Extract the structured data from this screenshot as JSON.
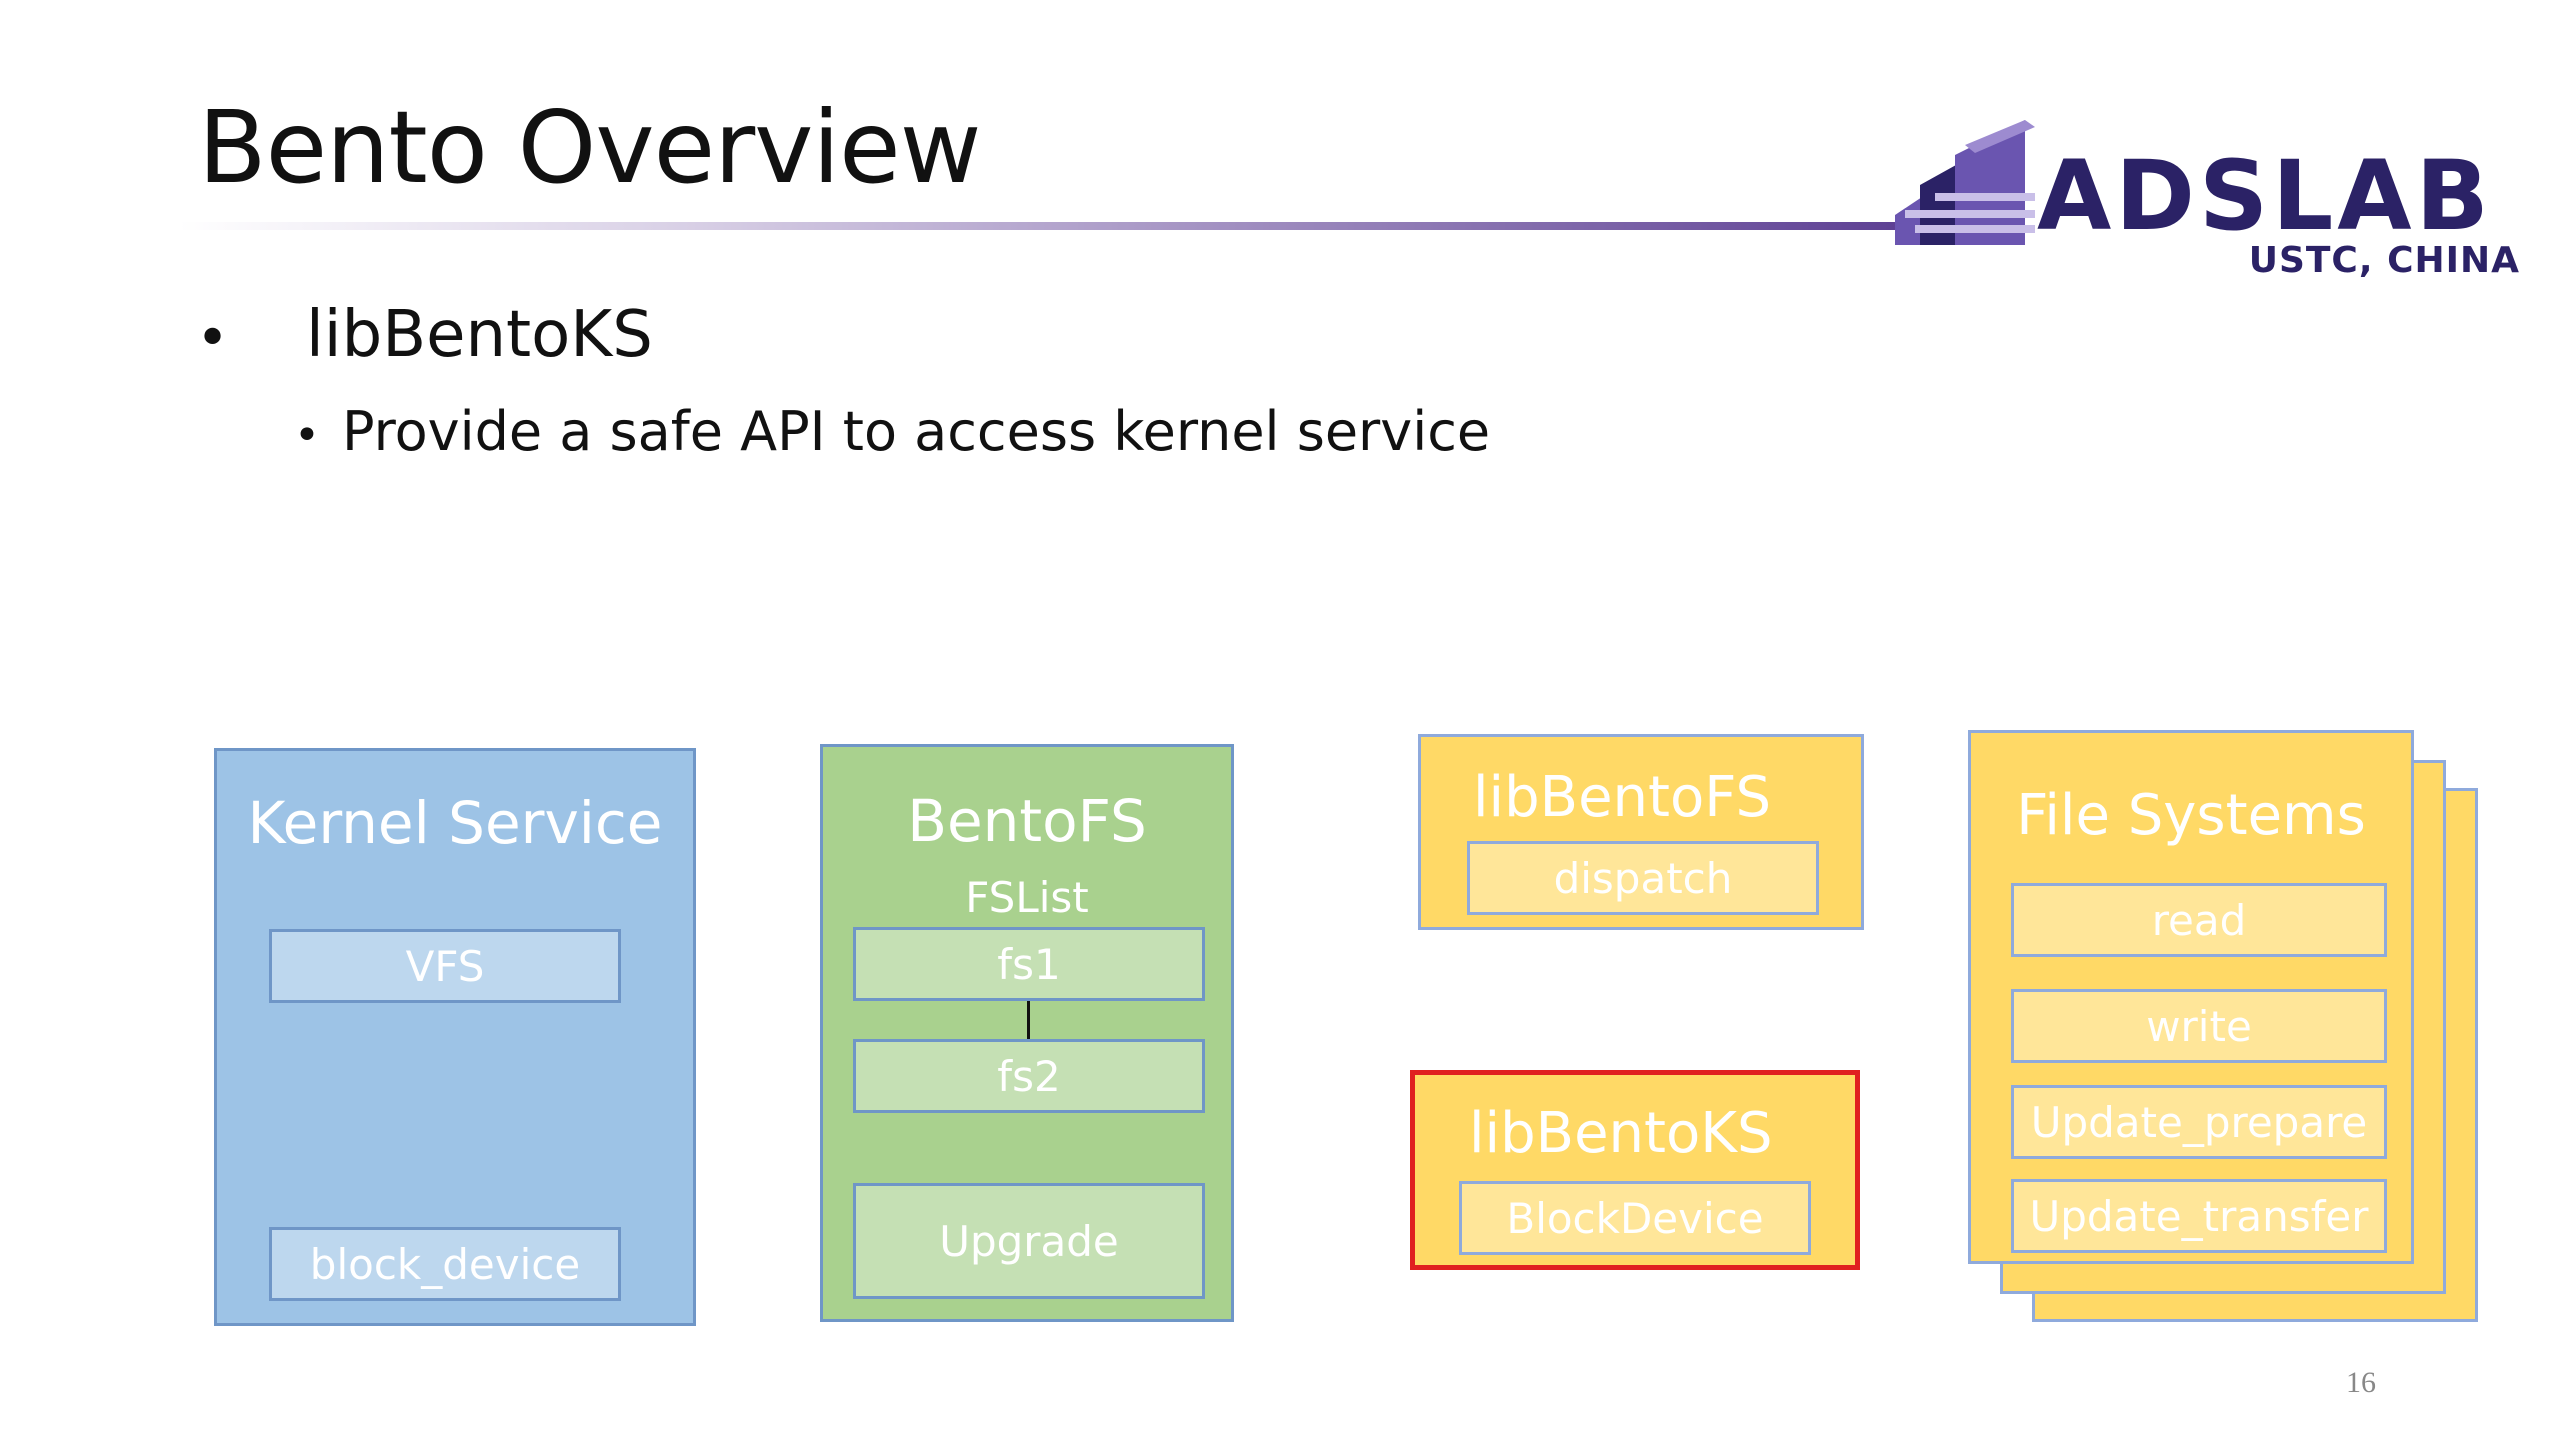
{
  "slide": {
    "title": "Bento Overview",
    "page_number": "16"
  },
  "logo": {
    "small_text": "USTC, CHINA",
    "big_text": "ADSLAB",
    "colors": {
      "dark": "#2b2266",
      "light": "#9d8bd0",
      "mid": "#6a55b0"
    }
  },
  "bullets": [
    {
      "text": "libBentoKS",
      "level": 1
    },
    {
      "text": "Provide a safe API to access kernel service",
      "level": 2
    }
  ],
  "diagram": {
    "kernel_service": {
      "title": "Kernel Service",
      "items": [
        "VFS",
        "block_device"
      ],
      "color": "#9dc3e6"
    },
    "bentofs": {
      "title": "BentoFS",
      "subtitle": "FSList",
      "items": [
        "fs1",
        "fs2",
        "Upgrade"
      ],
      "color": "#a9d18e"
    },
    "libbentofs": {
      "title": "libBentoFS",
      "items": [
        "dispatch"
      ],
      "color": "#ffd966"
    },
    "libbentoks": {
      "title": "libBentoKS",
      "items": [
        "BlockDevice"
      ],
      "color": "#ffd966",
      "highlight_border": "#e02020"
    },
    "file_systems": {
      "title": "File Systems",
      "items": [
        "read",
        "write",
        "Update_prepare",
        "Update_transfer"
      ],
      "color": "#ffd966"
    }
  }
}
